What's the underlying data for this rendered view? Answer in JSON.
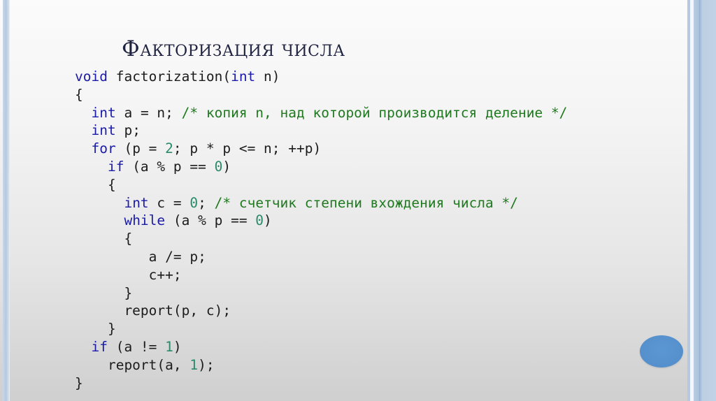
{
  "slide": {
    "title": "Факторизация числа",
    "code_lines": [
      [
        {
          "t": "kw",
          "v": "void"
        },
        {
          "t": "tx",
          "v": " factorization("
        },
        {
          "t": "kw",
          "v": "int"
        },
        {
          "t": "tx",
          "v": " n)"
        }
      ],
      [
        {
          "t": "tx",
          "v": "{"
        }
      ],
      [
        {
          "t": "tx",
          "v": "  "
        },
        {
          "t": "kw",
          "v": "int"
        },
        {
          "t": "tx",
          "v": " a = n; "
        },
        {
          "t": "cm",
          "v": "/* копия n, над которой производится деление */"
        }
      ],
      [
        {
          "t": "tx",
          "v": "  "
        },
        {
          "t": "kw",
          "v": "int"
        },
        {
          "t": "tx",
          "v": " p;"
        }
      ],
      [
        {
          "t": "tx",
          "v": "  "
        },
        {
          "t": "kw",
          "v": "for"
        },
        {
          "t": "tx",
          "v": " (p = "
        },
        {
          "t": "num",
          "v": "2"
        },
        {
          "t": "tx",
          "v": "; p * p <= n; ++p)"
        }
      ],
      [
        {
          "t": "tx",
          "v": "    "
        },
        {
          "t": "kw",
          "v": "if"
        },
        {
          "t": "tx",
          "v": " (a % p == "
        },
        {
          "t": "num",
          "v": "0"
        },
        {
          "t": "tx",
          "v": ")"
        }
      ],
      [
        {
          "t": "tx",
          "v": "    {"
        }
      ],
      [
        {
          "t": "tx",
          "v": "      "
        },
        {
          "t": "kw",
          "v": "int"
        },
        {
          "t": "tx",
          "v": " c = "
        },
        {
          "t": "num",
          "v": "0"
        },
        {
          "t": "tx",
          "v": "; "
        },
        {
          "t": "cm",
          "v": "/* счетчик степени вхождения числа */"
        }
      ],
      [
        {
          "t": "tx",
          "v": "      "
        },
        {
          "t": "kw",
          "v": "while"
        },
        {
          "t": "tx",
          "v": " (a % p == "
        },
        {
          "t": "num",
          "v": "0"
        },
        {
          "t": "tx",
          "v": ")"
        }
      ],
      [
        {
          "t": "tx",
          "v": "      {"
        }
      ],
      [
        {
          "t": "tx",
          "v": "         a /= p;"
        }
      ],
      [
        {
          "t": "tx",
          "v": "         c++;"
        }
      ],
      [
        {
          "t": "tx",
          "v": "      }"
        }
      ],
      [
        {
          "t": "tx",
          "v": "      report(p, c);"
        }
      ],
      [
        {
          "t": "tx",
          "v": "    }"
        }
      ],
      [
        {
          "t": "tx",
          "v": "  "
        },
        {
          "t": "kw",
          "v": "if"
        },
        {
          "t": "tx",
          "v": " (a != "
        },
        {
          "t": "num",
          "v": "1"
        },
        {
          "t": "tx",
          "v": ")"
        }
      ],
      [
        {
          "t": "tx",
          "v": "    report(a, "
        },
        {
          "t": "num",
          "v": "1"
        },
        {
          "t": "tx",
          "v": ");"
        }
      ],
      [
        {
          "t": "tx",
          "v": "}"
        }
      ]
    ]
  },
  "colors": {
    "keyword": "#1b1ba8",
    "number": "#2a8a6a",
    "comment": "#1f7a1f",
    "text": "#1c1c1c",
    "title": "#1f2340",
    "accent_circle": "#5590cc",
    "stripe": "#b6c9df"
  }
}
